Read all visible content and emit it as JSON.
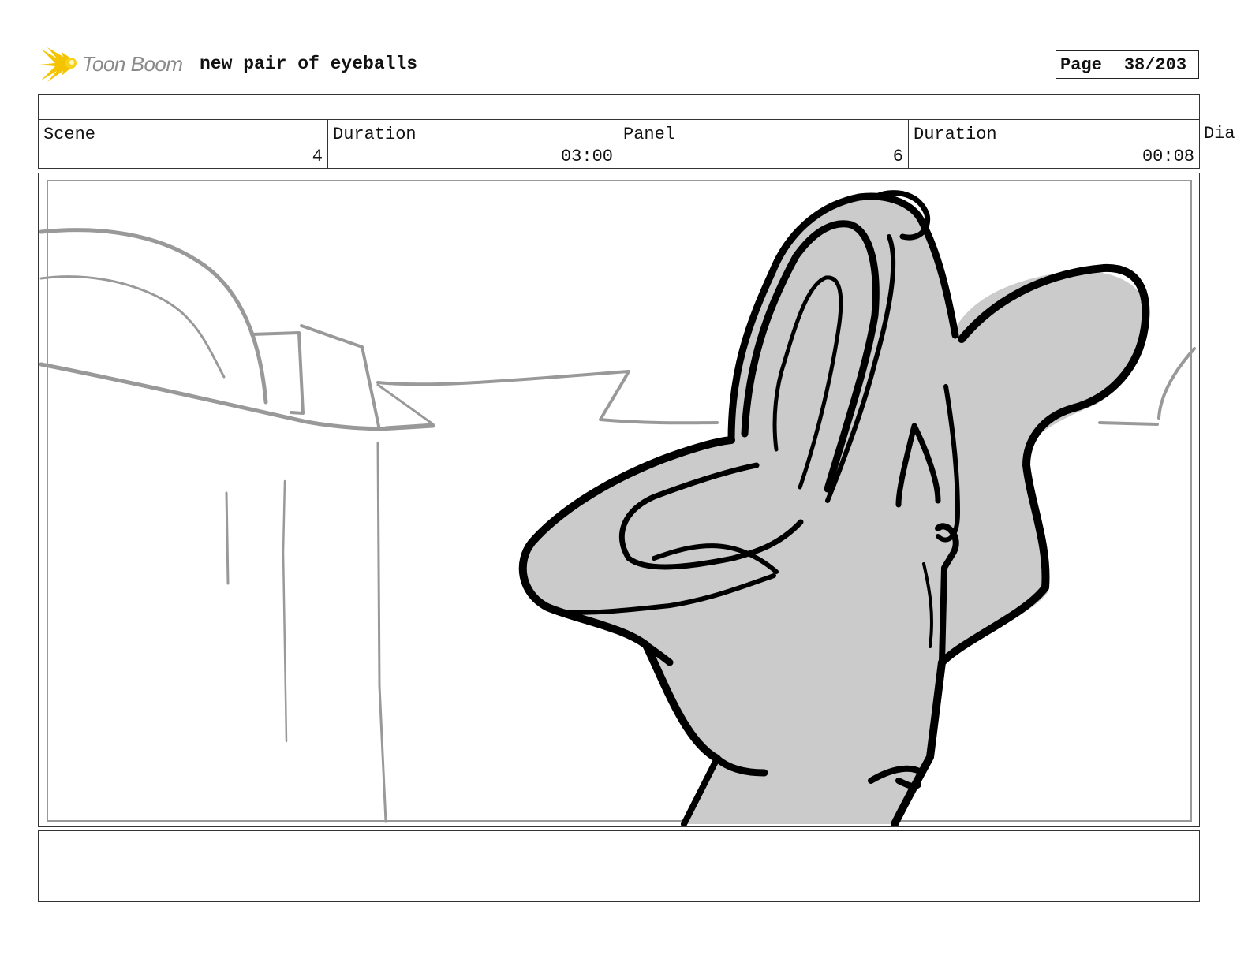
{
  "header": {
    "logo_text": "Toon Boom",
    "title": "new pair of eyeballs",
    "page_label": "Page",
    "page_value": "38/203"
  },
  "info": {
    "scene_label": "Scene",
    "scene_value": "4",
    "scene_duration_label": "Duration",
    "scene_duration_value": "03:00",
    "panel_label": "Panel",
    "panel_value": "6",
    "panel_duration_label": "Duration",
    "panel_duration_value": "00:08",
    "dialog_label": "Dia"
  },
  "colors": {
    "logo_star": "#f5c400",
    "sketch_gray": "#999999",
    "fill_gray": "#cccccc",
    "ink": "#000000"
  }
}
